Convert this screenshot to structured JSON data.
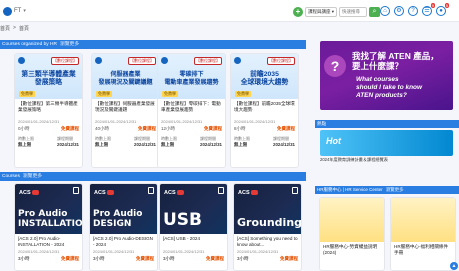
{
  "header": {
    "logo_text": "FT",
    "search_select": "課程與講座",
    "search_placeholder": "快速搜尋",
    "plus_label": "+",
    "search_button": "⌕",
    "icons": [
      "home-icon",
      "settings-icon",
      "help-icon",
      "notification-icon",
      "user-icon"
    ],
    "badges": [
      "9",
      "5"
    ]
  },
  "breadcrumb": {
    "items": [
      "首頁",
      ">",
      "首頁"
    ]
  },
  "sections": {
    "hr_courses": {
      "title": "Courses organized by HR",
      "sub": "瀏覽更多"
    },
    "courses": {
      "title": "Courses",
      "sub": "瀏覽更多"
    },
    "hot": {
      "title": "熱點"
    },
    "hr_center": {
      "title": "HR服務中心 | HR Service Center",
      "sub": "瀏覽更多"
    }
  },
  "hr_cards": [
    {
      "banner": "【數位課程】",
      "headline": "第三類半導體產業\n發展策略",
      "tag": "免費學",
      "title": "【數位課程】第三類半導體產業發展策略",
      "date": "2024/01/01-2024/12/31",
      "left": "0小時",
      "price": "免費課程",
      "foot_a_label": "時數上限",
      "foot_a": "無上限",
      "foot_b_label": "課程期間",
      "foot_b": "2024/12/31"
    },
    {
      "banner": "【數位課程】",
      "headline": "伺服器產業\n發展現況及關鍵議題",
      "tag": "免費學",
      "title": "【數位課程】伺服器產業發展現況及關鍵議題",
      "date": "2024/01/01-2024/12/31",
      "left": "40小時",
      "price": "免費課程",
      "foot_a_label": "時數上限",
      "foot_a": "無上限",
      "foot_b_label": "課程期間",
      "foot_b": "2024/12/31"
    },
    {
      "banner": "【數位課程】",
      "headline": "零碳排下\n電動車產業發展趨勢",
      "tag": "免費學",
      "title": "【數位課程】零碳排下：電動車產業發展趨勢",
      "date": "2024/01/01-2024/12/31",
      "left": "12小時",
      "price": "免費課程",
      "foot_a_label": "時數上限",
      "foot_a": "無上限",
      "foot_b_label": "課程期間",
      "foot_b": "2024/12/31"
    },
    {
      "banner": "【數位課程】",
      "headline": "前瞻2035\n全球環境大趨勢",
      "tag": "免費學",
      "title": "【數位課程】前瞻2035全球環境大趨勢",
      "date": "2024/01/01-2024/12/31",
      "left": "8小時",
      "price": "免費課程",
      "foot_a_label": "時數上限",
      "foot_a": "無上限",
      "foot_b_label": "課程期間",
      "foot_b": "2024/12/31"
    }
  ],
  "course_cards": [
    {
      "acs": "ACS",
      "big": "Pro Audio\nINSTALLATION",
      "title": "[ACS 2.0] Pro Audio-INSTALLATION - 2024",
      "date": "2024/01/01-2024/12/31",
      "left": "3小時",
      "price": "免費課程"
    },
    {
      "acs": "ACS",
      "big": "Pro Audio\nDESIGN",
      "title": "[ACS 2.0] Pro Audio-DESIGN - 2024",
      "date": "2024/01/01-2024/12/31",
      "left": "3小時",
      "price": "免費課程"
    },
    {
      "acs": "ACS",
      "big": "USB",
      "title": "[ACS] USB - 2024",
      "date": "2024/01/01-2024/12/31",
      "left": "3小時",
      "price": "免費課程"
    },
    {
      "acs": "ACS",
      "big": "Grounding",
      "title": "[ACS] Something you need to know about...",
      "date": "2024/01/01-2024/12/31",
      "left": "3小時",
      "price": "免費課程"
    }
  ],
  "ads": {
    "aten_line1": "我找了解 ATEN 產品，\n要上什麼課？",
    "aten_line2": "What courses\nshould I take to know\nATEN products?",
    "qmark": "?",
    "hot_text": "Hot",
    "hot_caption": "2024年度教育訓練計畫＆課程總覽表"
  },
  "hr_center_cards": [
    {
      "title": "HR服務中心-勞資權益說明(2024)"
    },
    {
      "title": "HR服務中心-福利相關條件手冊"
    }
  ],
  "scroll_top": "▲"
}
